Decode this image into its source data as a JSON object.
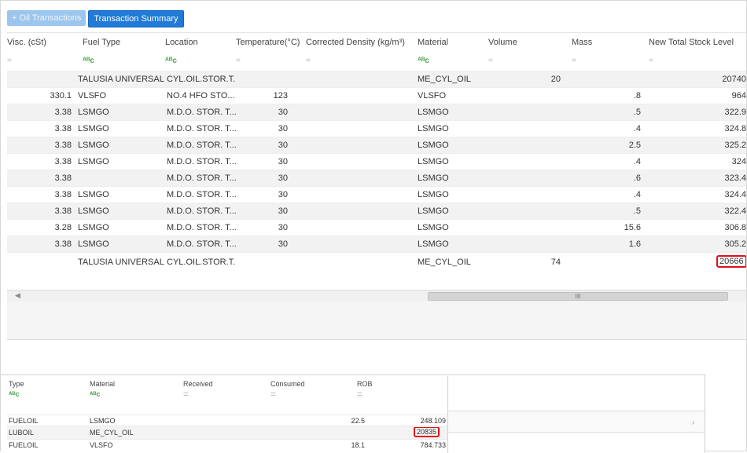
{
  "toolbar": {
    "oil_transactions_label": "+ Oil Transactions",
    "transaction_summary_label": "Transaction Summary"
  },
  "grid": {
    "columns": [
      "Visc. (cSt)",
      "Fuel Type",
      "Location",
      "Temperature(°C)",
      "Corrected Density (kg/m³)",
      "Material",
      "Volume",
      "Mass",
      "New Total Stock Level"
    ],
    "filter_eq": "=",
    "filter_fx": "ᴬᴮc",
    "rows": [
      {
        "visc": "",
        "fuel_type": "TALUSIA UNIVERSAL",
        "location": "CYL.OIL.STOR.T...",
        "temp": "",
        "density": "",
        "material": "ME_CYL_OIL",
        "volume": "20",
        "mass": "",
        "stock": "20740"
      },
      {
        "visc": "330.1",
        "fuel_type": "VLSFO",
        "location": "NO.4 HFO  STO...",
        "temp": "123",
        "density": "",
        "material": "VLSFO",
        "volume": "",
        "mass": ".8",
        "stock": "964"
      },
      {
        "visc": "3.38",
        "fuel_type": "LSMGO",
        "location": "M.D.O.  STOR. T...",
        "temp": "30",
        "density": "",
        "material": "LSMGO",
        "volume": "",
        "mass": ".5",
        "stock": "322.9"
      },
      {
        "visc": "3.38",
        "fuel_type": "LSMGO",
        "location": "M.D.O.  STOR. T...",
        "temp": "30",
        "density": "",
        "material": "LSMGO",
        "volume": "",
        "mass": ".4",
        "stock": "324.8"
      },
      {
        "visc": "3.38",
        "fuel_type": "LSMGO",
        "location": "M.D.O.  STOR. T...",
        "temp": "30",
        "density": "",
        "material": "LSMGO",
        "volume": "",
        "mass": "2.5",
        "stock": "325.2"
      },
      {
        "visc": "3.38",
        "fuel_type": "LSMGO",
        "location": "M.D.O.  STOR. T...",
        "temp": "30",
        "density": "",
        "material": "LSMGO",
        "volume": "",
        "mass": ".4",
        "stock": "324"
      },
      {
        "visc": "3.38",
        "fuel_type": "",
        "location": "M.D.O.  STOR. T...",
        "temp": "30",
        "density": "",
        "material": "LSMGO",
        "volume": "",
        "mass": ".6",
        "stock": "323.4"
      },
      {
        "visc": "3.38",
        "fuel_type": "LSMGO",
        "location": "M.D.O.  STOR. T...",
        "temp": "30",
        "density": "",
        "material": "LSMGO",
        "volume": "",
        "mass": ".4",
        "stock": "324.4"
      },
      {
        "visc": "3.38",
        "fuel_type": "LSMGO",
        "location": "M.D.O.  STOR. T...",
        "temp": "30",
        "density": "",
        "material": "LSMGO",
        "volume": "",
        "mass": ".5",
        "stock": "322.4"
      },
      {
        "visc": "3.28",
        "fuel_type": "LSMGO",
        "location": "M.D.O.  STOR. T...",
        "temp": "30",
        "density": "",
        "material": "LSMGO",
        "volume": "",
        "mass": "15.6",
        "stock": "306.8"
      },
      {
        "visc": "3.38",
        "fuel_type": "LSMGO",
        "location": "M.D.O.  STOR. T...",
        "temp": "30",
        "density": "",
        "material": "LSMGO",
        "volume": "",
        "mass": "1.6",
        "stock": "305.2"
      },
      {
        "visc": "",
        "fuel_type": "TALUSIA UNIVERSAL",
        "location": "CYL.OIL.STOR.T...",
        "temp": "",
        "density": "",
        "material": "ME_CYL_OIL",
        "volume": "74",
        "mass": "",
        "stock": "20666"
      }
    ],
    "scroll_thumb_label": "III"
  },
  "summary": {
    "columns": [
      "Type",
      "Material",
      "Received",
      "Consumed",
      "ROB"
    ],
    "rows": [
      {
        "type": "FUELOIL",
        "material": "LSMGO",
        "received": "",
        "consumed": "22.5",
        "rob": "248.109"
      },
      {
        "type": "LUBOIL",
        "material": "ME_CYL_OIL",
        "received": "",
        "consumed": "",
        "rob": "20835"
      },
      {
        "type": "FUELOIL",
        "material": "VLSFO",
        "received": "",
        "consumed": "18.1",
        "rob": "784.733"
      }
    ]
  },
  "colors": {
    "accent": "#1f7ad8",
    "highlight": "#e0101a",
    "fx_icon": "#45a34a"
  }
}
